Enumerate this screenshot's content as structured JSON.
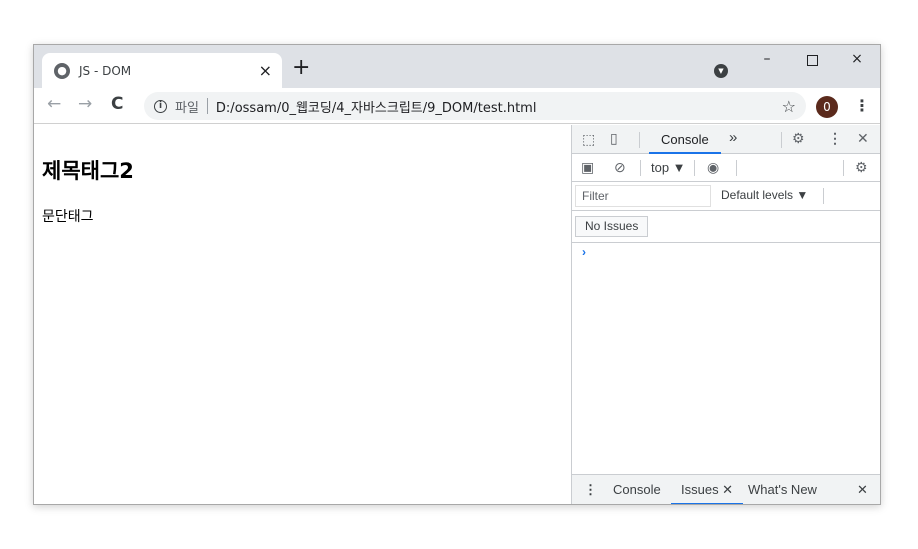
{
  "tab": {
    "title": "JS - DOM",
    "close": "×",
    "new_tab": "+"
  },
  "window_controls": {
    "minimize": "–",
    "close": "×"
  },
  "toolbar": {
    "back": "←",
    "forward": "→",
    "reload": "C",
    "info_icon": "i",
    "scheme_label": "파일",
    "url": "D:/ossam/0_웹코딩/4_자바스크립트/9_DOM/test.html",
    "star": "☆",
    "avatar_letter": "0",
    "menu": "⋮"
  },
  "page": {
    "heading": "제목태그2",
    "paragraph": "문단태그"
  },
  "devtools": {
    "tabs": {
      "console": "Console",
      "more": "»",
      "settings": "⚙",
      "kebab": "⋮",
      "close": "✕"
    },
    "toolbar2": {
      "context": "top ▼",
      "settings": "⚙"
    },
    "filter": {
      "placeholder": "Filter",
      "levels": "Default levels ▼"
    },
    "issues_button": "No Issues",
    "prompt": "›",
    "drawer": {
      "kebab": "⋮",
      "console": "Console",
      "issues": "Issues ✕",
      "whats_new": "What's New",
      "close": "✕"
    }
  },
  "colors": {
    "accent": "#1a73e8",
    "titlebar": "#dee1e6",
    "avatar": "#5b2a1c"
  }
}
